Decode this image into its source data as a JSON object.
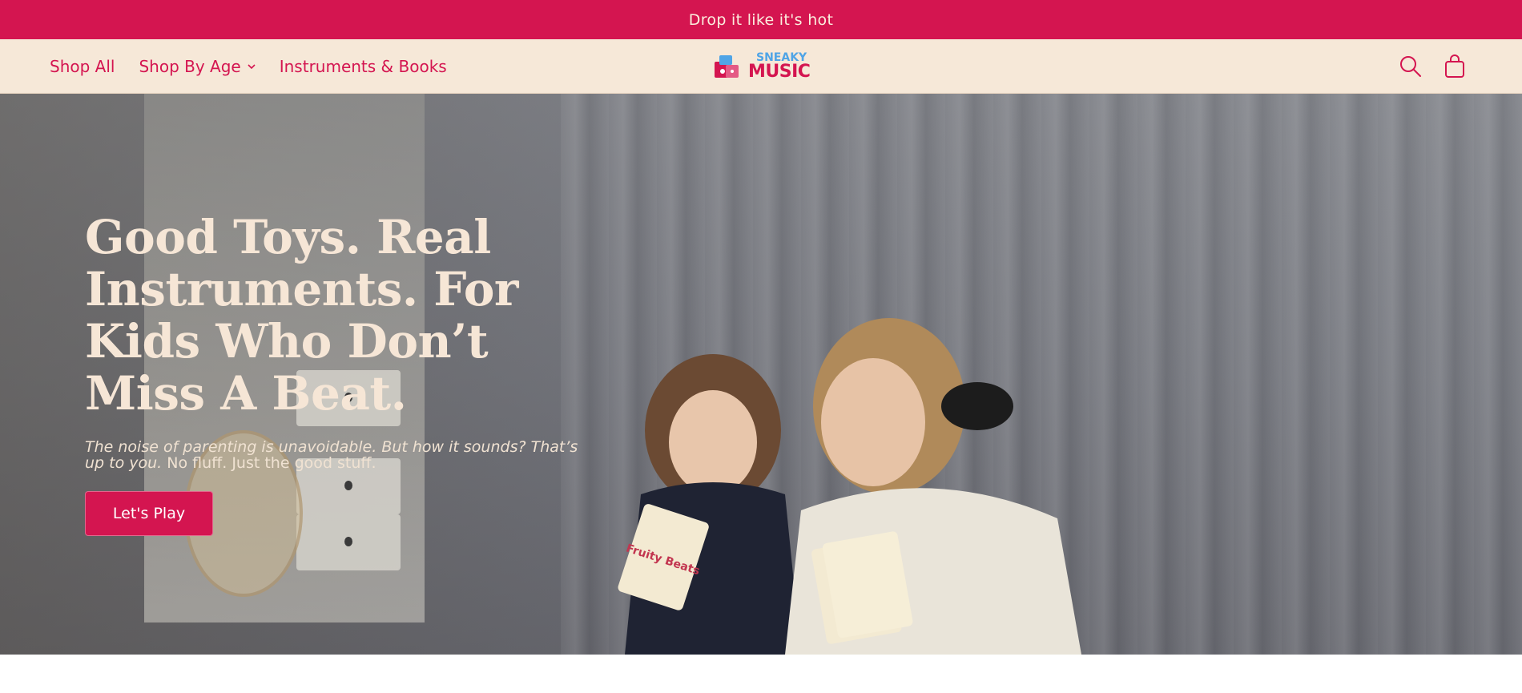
{
  "announcement": {
    "text": "Drop it like it's hot"
  },
  "nav": {
    "items": [
      {
        "label": "Shop All"
      },
      {
        "label": "Shop By Age"
      },
      {
        "label": "Instruments & Books"
      }
    ]
  },
  "logo": {
    "top": "SNEAKY",
    "bottom": "MUSIC"
  },
  "icons": {
    "search": "search-icon",
    "cart": "cart-icon"
  },
  "hero": {
    "headline": "Good Toys. Real Instruments. For Kids Who Don’t Miss A Beat.",
    "subtext_italic": "The noise of parenting is unavoidable. But how it sounds? That’s up to you.",
    "subtext_plain": " No fluff. Just the good stuff.",
    "cta_label": "Let's Play",
    "card_text": "Fruity Beats"
  },
  "colors": {
    "brand": "#d41550",
    "header_bg": "#f6e8d8",
    "text_cream": "#f6e6d6"
  }
}
